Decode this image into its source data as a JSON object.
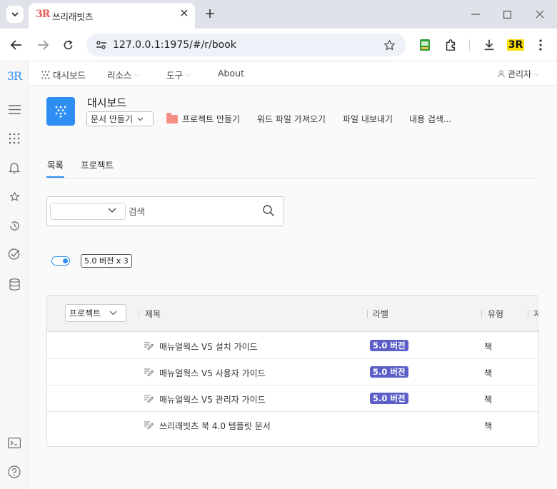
{
  "browser": {
    "tab_title": "쓰리래빗츠",
    "favicon_text": "3R",
    "url": "127.0.0.1:1975/#/r/book",
    "extension_label": "3R"
  },
  "app": {
    "logo": "3R",
    "nav": {
      "dashboard": "대시보드",
      "resources": "리소스",
      "tools": "도구",
      "about": "About",
      "user": "관리자"
    }
  },
  "page": {
    "title": "대시보드",
    "doc_create": "문서 만들기",
    "actions": [
      "프로젝트 만들기",
      "워드 파일 가져오기",
      "파일 내보내기",
      "내용 검색..."
    ],
    "tabs": [
      "목록",
      "프로젝트"
    ],
    "active_tab": "목록"
  },
  "search": {
    "placeholder": "검색",
    "filter_value": ""
  },
  "filter": {
    "toggle_on": true,
    "chip": "5.0 버전 x 3"
  },
  "table": {
    "project_select": "프로젝트",
    "headers": {
      "title": "제목",
      "label": "라벨",
      "type": "유형",
      "extra": "저"
    },
    "rows": [
      {
        "title": "매뉴얼웍스 V5 설치 가이드",
        "label": "5.0 버전",
        "type": "책"
      },
      {
        "title": "매뉴얼웍스 V5 사용자 가이드",
        "label": "5.0 버전",
        "type": "책"
      },
      {
        "title": "매뉴얼웍스 V5 관리자 가이드",
        "label": "5.0 버전",
        "type": "책"
      },
      {
        "title": "쓰리래빗츠 북 4.0 템플릿 문서",
        "label": "",
        "type": "책"
      }
    ]
  },
  "colors": {
    "accent": "#2f8ef4",
    "badge": "#5b5fc7",
    "folder": "#f58f86"
  }
}
